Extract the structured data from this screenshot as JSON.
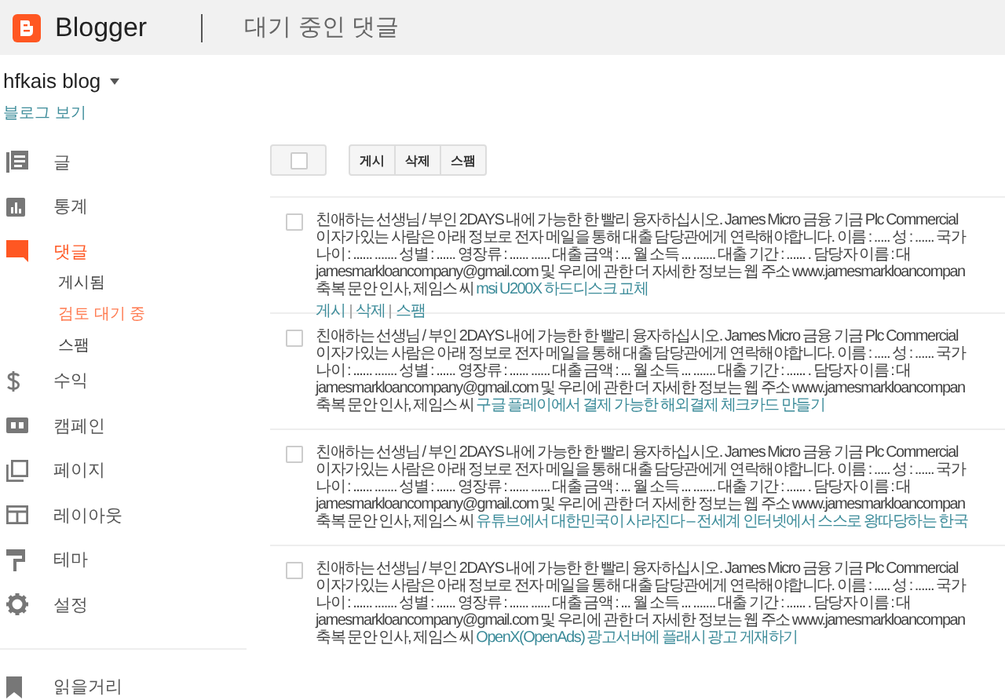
{
  "header": {
    "app_name": "Blogger",
    "page_title": "대기 중인 댓글"
  },
  "blog": {
    "name": "hfkais blog",
    "view_link": "블로그 보기"
  },
  "nav": [
    {
      "label": "글",
      "selected": false
    },
    {
      "label": "통계",
      "selected": false
    },
    {
      "label": "댓글",
      "selected": true,
      "children": [
        {
          "label": "게시됨",
          "selected": false
        },
        {
          "label": "검토 대기 중",
          "selected": true
        },
        {
          "label": "스팸",
          "selected": false
        }
      ]
    },
    {
      "label": "수익",
      "selected": false
    },
    {
      "label": "캠페인",
      "selected": false
    },
    {
      "label": "페이지",
      "selected": false
    },
    {
      "label": "레이아웃",
      "selected": false
    },
    {
      "label": "테마",
      "selected": false
    },
    {
      "label": "설정",
      "selected": false
    }
  ],
  "reading_list": {
    "label": "읽을거리"
  },
  "toolbar": {
    "select_all_checked": false,
    "actions": [
      "게시",
      "삭제",
      "스팸"
    ]
  },
  "comments": [
    {
      "checked": false,
      "lines": [
        "친애하는 선생님 / 부인 2DAYS 내에 가능한 한 빨리 융자하십시오. James Micro 금융 기금 Plc Commercial",
        "이자가있는 사람은 아래 정보로 전자 메일을 통해 대출 담당관에게 연락해야합니다. 이름 : ..... 성 : ...... 국가",
        "나이 : ...... ....... 성별 : ...... 영장류 : ...... ...... 대출 금액 : ... 월 소득 ... ....... 대출 기간 : ...... . 담당자 이름 : 대",
        "jamesmarkloancompany@gmail.com 및 우리에 관한 더 자세한 정보는 웹 주소 www.jamesmarkloancompan"
      ],
      "closing": "축복 문안 인사, 제임스 씨",
      "post_link": "msi U200X 하드디스크 교체",
      "actions": [
        "게시",
        "삭제",
        "스팸"
      ]
    },
    {
      "checked": false,
      "lines": [
        "친애하는 선생님 / 부인 2DAYS 내에 가능한 한 빨리 융자하십시오. James Micro 금융 기금 Plc Commercial",
        "이자가있는 사람은 아래 정보로 전자 메일을 통해 대출 담당관에게 연락해야합니다. 이름 : ..... 성 : ...... 국가",
        "나이 : ...... ....... 성별 : ...... 영장류 : ...... ...... 대출 금액 : ... 월 소득 ... ....... 대출 기간 : ...... . 담당자 이름 : 대",
        "jamesmarkloancompany@gmail.com 및 우리에 관한 더 자세한 정보는 웹 주소 www.jamesmarkloancompan"
      ],
      "closing": "축복 문안 인사, 제임스 씨",
      "post_link": "구글 플레이에서 결제 가능한 해외결제 체크카드 만들기"
    },
    {
      "checked": false,
      "lines": [
        "친애하는 선생님 / 부인 2DAYS 내에 가능한 한 빨리 융자하십시오. James Micro 금융 기금 Plc Commercial",
        "이자가있는 사람은 아래 정보로 전자 메일을 통해 대출 담당관에게 연락해야합니다. 이름 : ..... 성 : ...... 국가",
        "나이 : ...... ....... 성별 : ...... 영장류 : ...... ...... 대출 금액 : ... 월 소득 ... ....... 대출 기간 : ...... . 담당자 이름 : 대",
        "jamesmarkloancompany@gmail.com 및 우리에 관한 더 자세한 정보는 웹 주소 www.jamesmarkloancompan"
      ],
      "closing": "축복 문안 인사, 제임스 씨",
      "post_link": "유튜브에서 대한민국이 사라진다 – 전세계 인터넷에서 스스로 왕따당하는 한국"
    },
    {
      "checked": false,
      "lines": [
        "친애하는 선생님 / 부인 2DAYS 내에 가능한 한 빨리 융자하십시오. James Micro 금융 기금 Plc Commercial",
        "이자가있는 사람은 아래 정보로 전자 메일을 통해 대출 담당관에게 연락해야합니다. 이름 : ..... 성 : ...... 국가",
        "나이 : ...... ....... 성별 : ...... 영장류 : ...... ...... 대출 금액 : ... 월 소득 ... ....... 대출 기간 : ...... . 담당자 이름 : 대",
        "jamesmarkloancompany@gmail.com 및 우리에 관한 더 자세한 정보는 웹 주소 www.jamesmarkloancompan"
      ],
      "closing": "축복 문안 인사, 제임스 씨",
      "post_link": "OpenX(OpenAds) 광고서버에 플래시 광고 게재하기"
    }
  ]
}
